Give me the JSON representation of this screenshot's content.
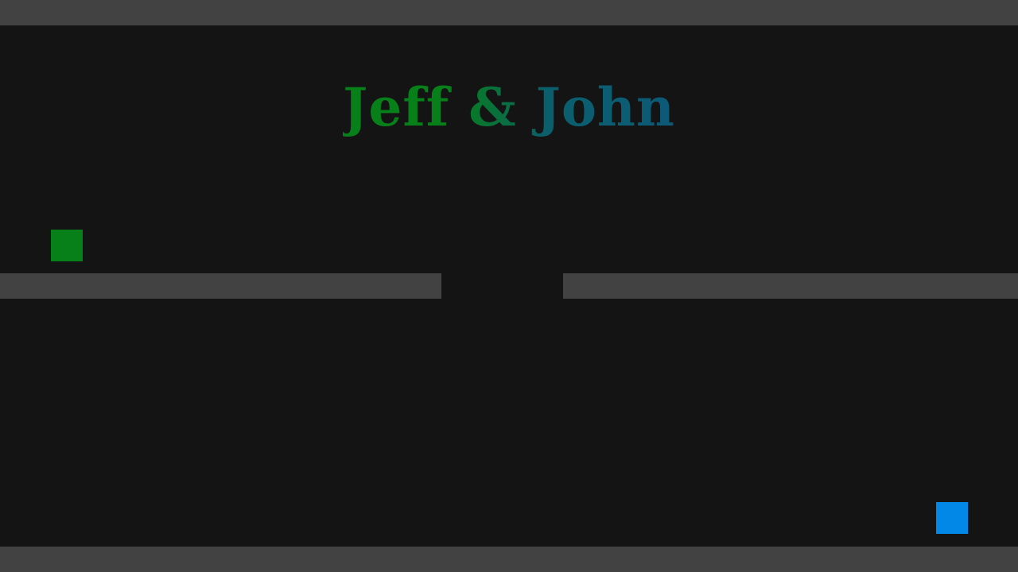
{
  "game": {
    "title_part_1": "Jeff &",
    "title_part_2": " John"
  },
  "players": {
    "jeff": {
      "color": "#07801a"
    },
    "john": {
      "color": "#0288e6"
    }
  },
  "colors": {
    "background": "#141414",
    "wall": "#424242",
    "title_green": "#07801a",
    "title_blue": "#0c5a78"
  }
}
